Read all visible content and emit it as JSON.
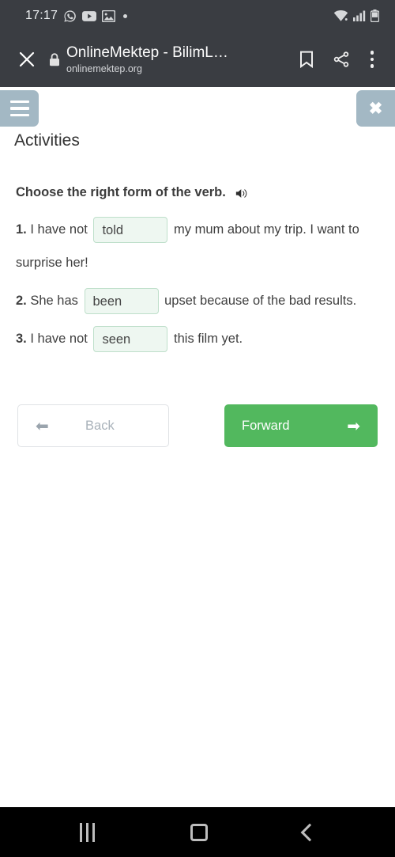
{
  "status_bar": {
    "clock": "17:17",
    "icons": [
      "whatsapp-icon",
      "youtube-icon",
      "gallery-icon",
      "notification-dot"
    ],
    "right_icons": [
      "wifi-icon",
      "cellular-signal-icon",
      "battery-icon"
    ]
  },
  "browser": {
    "close_label": "×",
    "title": "OnlineMektep - BilimL…",
    "url": "onlinemektep.org",
    "icons": [
      "lock-icon",
      "bookmark-icon",
      "share-icon",
      "overflow-menu-icon"
    ]
  },
  "page": {
    "menu_button_label": "menu",
    "close_button_label": "✖",
    "title": "Activities"
  },
  "exercise": {
    "instruction": "Choose the right form of the verb.",
    "audio_icon": "speaker-icon",
    "questions": [
      {
        "number": "1.",
        "text_before": "I have not",
        "answer": "told",
        "text_after": "my mum about my trip. I want to surprise her!"
      },
      {
        "number": "2.",
        "text_before": "She has",
        "answer": "been",
        "text_after": "upset because of the bad results."
      },
      {
        "number": "3.",
        "text_before": "I have not",
        "answer": "seen",
        "text_after": "this film yet."
      }
    ]
  },
  "navigation": {
    "back_label": "Back",
    "back_arrow": "⬅",
    "forward_label": "Forward",
    "forward_arrow": "➡"
  },
  "android_nav": {
    "recents_label": "recents",
    "home_label": "home",
    "back_label": "back"
  },
  "colors": {
    "toolbar": "#3a3d42",
    "accent_green": "#52b85e",
    "button_blue_gray": "#a3b8c4",
    "blank_bg": "#eef7f1",
    "blank_border": "#bedfca"
  }
}
